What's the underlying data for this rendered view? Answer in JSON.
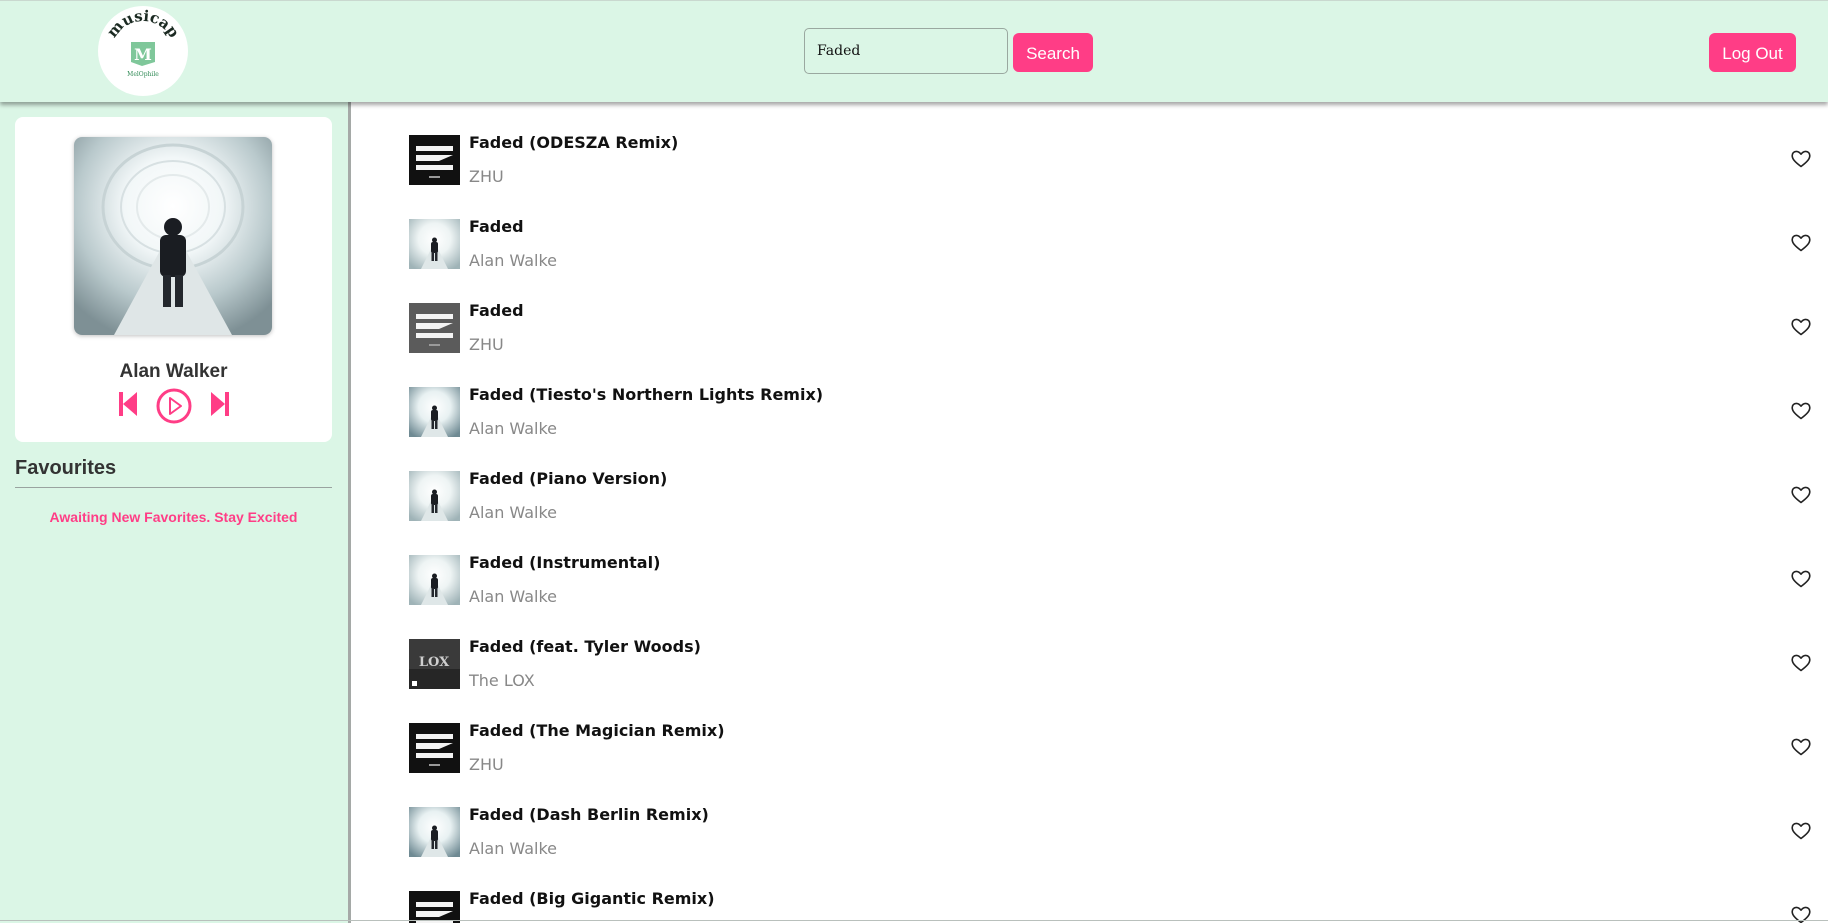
{
  "header": {
    "logo": {
      "brand": "musicap",
      "letter": "M",
      "tagline": "MelOphile"
    },
    "search": {
      "value": "Faded",
      "button_label": "Search"
    },
    "logout_label": "Log Out"
  },
  "player": {
    "artist": "Alan Walker",
    "controls": [
      "previous-icon",
      "play-icon",
      "next-icon"
    ]
  },
  "favourites": {
    "title": "Favourites",
    "empty_message": "Awaiting New Favorites. Stay Excited"
  },
  "songs": [
    {
      "title": "Faded (ODESZA Remix)",
      "artist": "ZHU",
      "cover": "zhu"
    },
    {
      "title": "Faded",
      "artist": "Alan Walke",
      "cover": "walker"
    },
    {
      "title": "Faded",
      "artist": "ZHU",
      "cover": "zhu-gray"
    },
    {
      "title": "Faded (Tiesto's Northern Lights Remix)",
      "artist": "Alan Walke",
      "cover": "walker-tunnel"
    },
    {
      "title": "Faded (Piano Version)",
      "artist": "Alan Walke",
      "cover": "walker"
    },
    {
      "title": "Faded (Instrumental)",
      "artist": "Alan Walke",
      "cover": "walker"
    },
    {
      "title": "Faded (feat. Tyler Woods)",
      "artist": "The LOX",
      "cover": "lox"
    },
    {
      "title": "Faded (The Magician Remix)",
      "artist": "ZHU",
      "cover": "zhu"
    },
    {
      "title": "Faded (Dash Berlin Remix)",
      "artist": "Alan Walke",
      "cover": "walker-tunnel"
    },
    {
      "title": "Faded (Big Gigantic Remix)",
      "artist": "",
      "cover": "zhu"
    }
  ],
  "colors": {
    "accent": "#ff3d86",
    "header_bg": "#dbf6e6",
    "sidebar_bg": "#dbf6e6"
  },
  "icons": {
    "favourite": "heart-outline-icon"
  }
}
